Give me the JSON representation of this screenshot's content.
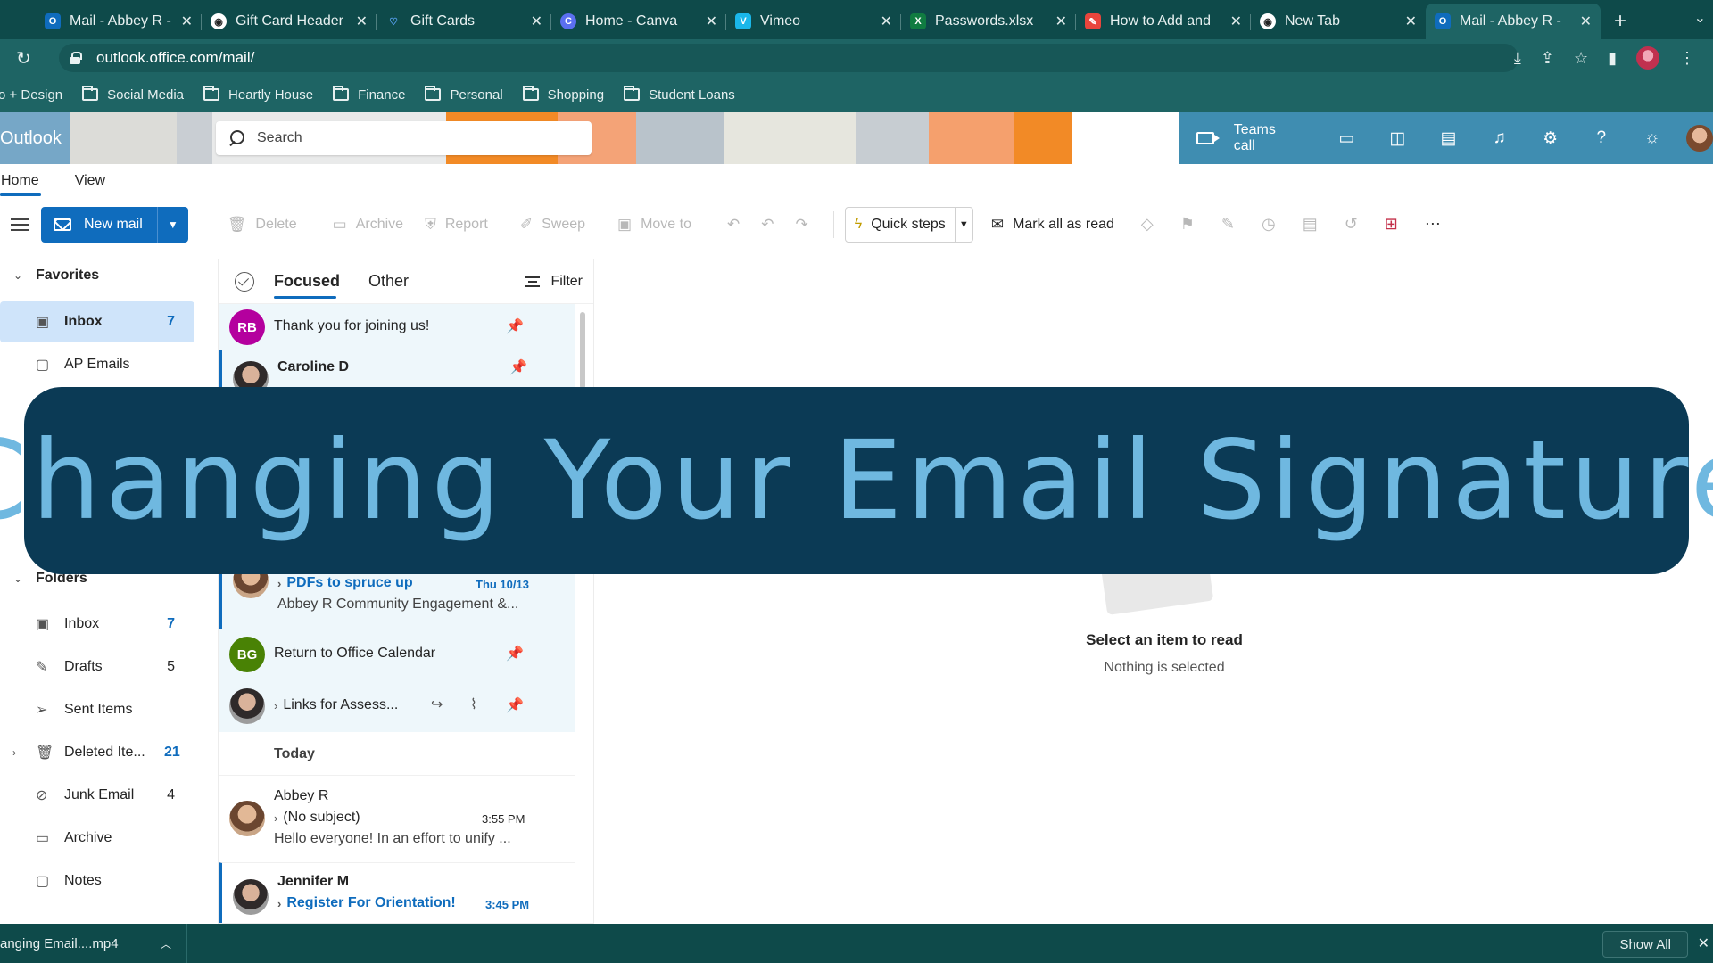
{
  "browser": {
    "tabs": [
      {
        "title": "Mail - Abbey R -",
        "icon": "outlook-icon",
        "color": "#0f6cbd",
        "glyph": "O"
      },
      {
        "title": "Gift Card Header",
        "icon": "chrome-icon",
        "color": "#5f6368",
        "glyph": "◉"
      },
      {
        "title": "Gift Cards",
        "icon": "heart-icon",
        "color": "#1a73e8",
        "glyph": "♡"
      },
      {
        "title": "Home - Canva",
        "icon": "canva-icon",
        "color": "#7d2ae8",
        "glyph": "C"
      },
      {
        "title": "Vimeo",
        "icon": "vimeo-icon",
        "color": "#1ab7ea",
        "glyph": "V"
      },
      {
        "title": "Passwords.xlsx",
        "icon": "excel-icon",
        "color": "#107c41",
        "glyph": "X"
      },
      {
        "title": "How to Add and",
        "icon": "tool-icon",
        "color": "#e8453c",
        "glyph": "✎"
      },
      {
        "title": "New Tab",
        "icon": "chrome-icon",
        "color": "#5f6368",
        "glyph": "◉"
      },
      {
        "title": "Mail - Abbey R -",
        "icon": "outlook-icon",
        "color": "#0f6cbd",
        "glyph": "O"
      }
    ],
    "active_tab_index": 8,
    "url": "outlook.office.com/mail/",
    "bookmarks": [
      "o + Design",
      "Social Media",
      "Heartly House",
      "Finance",
      "Personal",
      "Shopping",
      "Student Loans"
    ]
  },
  "outlook": {
    "brand": "Outlook",
    "search_placeholder": "Search",
    "teams_call": "Teams call",
    "ribbon_tabs": [
      "Home",
      "View"
    ],
    "commands": {
      "new_mail": "New mail",
      "delete": "Delete",
      "archive": "Archive",
      "report": "Report",
      "sweep": "Sweep",
      "move_to": "Move to",
      "quick_steps": "Quick steps",
      "mark_all_read": "Mark all as read"
    }
  },
  "nav": {
    "favorites_label": "Favorites",
    "favorites": [
      {
        "label": "Inbox",
        "count": "7",
        "icon": "inbox-icon"
      },
      {
        "label": "AP Emails",
        "count": "",
        "icon": "folder-icon"
      }
    ],
    "folders_label": "Folders",
    "folders": [
      {
        "label": "Inbox",
        "count": "7",
        "icon": "inbox-icon"
      },
      {
        "label": "Drafts",
        "count": "5",
        "icon": "drafts-icon"
      },
      {
        "label": "Sent Items",
        "count": "",
        "icon": "send-icon"
      },
      {
        "label": "Deleted Ite...",
        "count": "21",
        "icon": "trash-icon"
      },
      {
        "label": "Junk Email",
        "count": "4",
        "icon": "junk-icon"
      },
      {
        "label": "Archive",
        "count": "",
        "icon": "archive-icon"
      },
      {
        "label": "Notes",
        "count": "",
        "icon": "notes-icon"
      }
    ]
  },
  "messages": {
    "tabs": [
      "Focused",
      "Other"
    ],
    "filter": "Filter",
    "items": [
      {
        "avatar": "RB",
        "avatar_color": "#b4009e",
        "subject": "Thank you for joining us!"
      },
      {
        "name": "Caroline D"
      },
      {
        "subject": "PDFs to spruce up",
        "time": "Thu 10/13",
        "preview": "Abbey R Community Engagement &..."
      },
      {
        "avatar": "BG",
        "avatar_color": "#498205",
        "subject": "Return to Office Calendar"
      },
      {
        "subject": "Links for Assess..."
      },
      {
        "name": "Abbey R",
        "subject": "(No subject)",
        "time": "3:55 PM",
        "preview": "Hello everyone! In an effort to unify ..."
      },
      {
        "name": "Jennifer M",
        "subject": "Register For Orientation!",
        "time": "3:45 PM"
      }
    ],
    "group_today": "Today"
  },
  "reading": {
    "title": "Select an item to read",
    "subtitle": "Nothing is selected"
  },
  "overlay": {
    "title": "Changing Your Email Signature"
  },
  "download": {
    "file": "anging Email....mp4",
    "show_all": "Show All"
  }
}
